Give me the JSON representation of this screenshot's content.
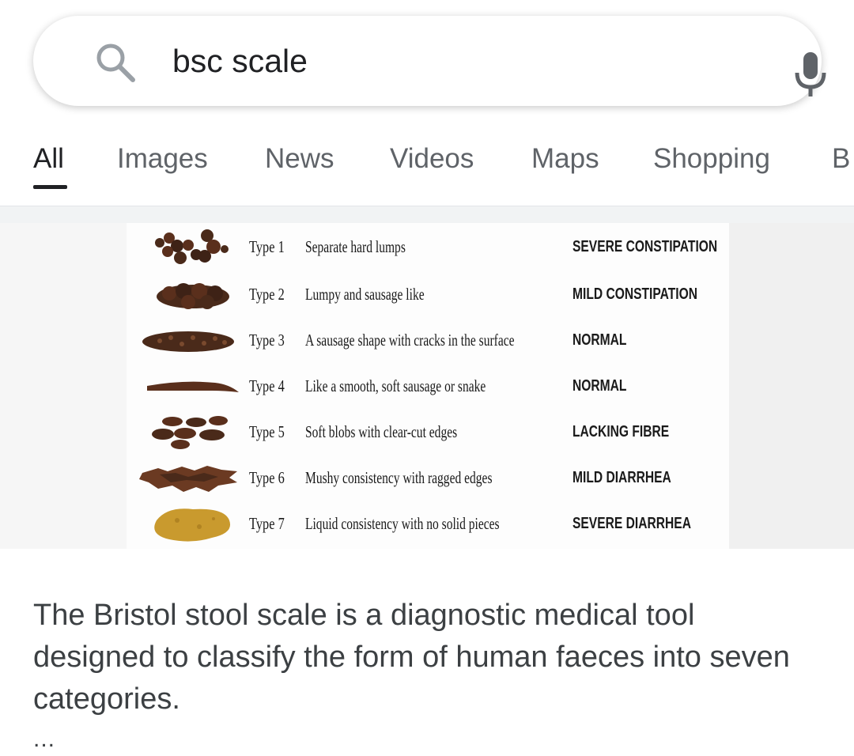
{
  "search": {
    "query": "bsc scale",
    "search_icon": "search-icon",
    "mic_icon": "microphone-icon"
  },
  "tabs": [
    {
      "label": "All",
      "active": true
    },
    {
      "label": "Images",
      "active": false
    },
    {
      "label": "News",
      "active": false
    },
    {
      "label": "Videos",
      "active": false
    },
    {
      "label": "Maps",
      "active": false
    },
    {
      "label": "Shopping",
      "active": false
    },
    {
      "label": "B",
      "active": false
    }
  ],
  "scale_image": {
    "rows": [
      {
        "type": "Type 1",
        "description": "Separate hard lumps",
        "category": "SEVERE CONSTIPATION"
      },
      {
        "type": "Type 2",
        "description": "Lumpy and sausage like",
        "category": "MILD CONSTIPATION"
      },
      {
        "type": "Type 3",
        "description": "A sausage shape with cracks in the surface",
        "category": "NORMAL"
      },
      {
        "type": "Type 4",
        "description": "Like a smooth, soft sausage or snake",
        "category": "NORMAL"
      },
      {
        "type": "Type 5",
        "description": "Soft blobs with clear-cut edges",
        "category": "LACKING FIBRE"
      },
      {
        "type": "Type 6",
        "description": "Mushy consistency with ragged edges",
        "category": "MILD DIARRHEA"
      },
      {
        "type": "Type 7",
        "description": "Liquid consistency with no solid pieces",
        "category": "SEVERE DIARRHEA"
      }
    ]
  },
  "snippet": {
    "text": "The Bristol stool scale is a diagnostic medical tool designed to classify the form of human faeces into seven categories.",
    "more": "..."
  },
  "colors": {
    "text_primary": "#202124",
    "text_secondary": "#5f6368",
    "stool_dark": "#4a2a1a",
    "stool_medium": "#6b3a22",
    "stool_liquid": "#c99a2e"
  }
}
